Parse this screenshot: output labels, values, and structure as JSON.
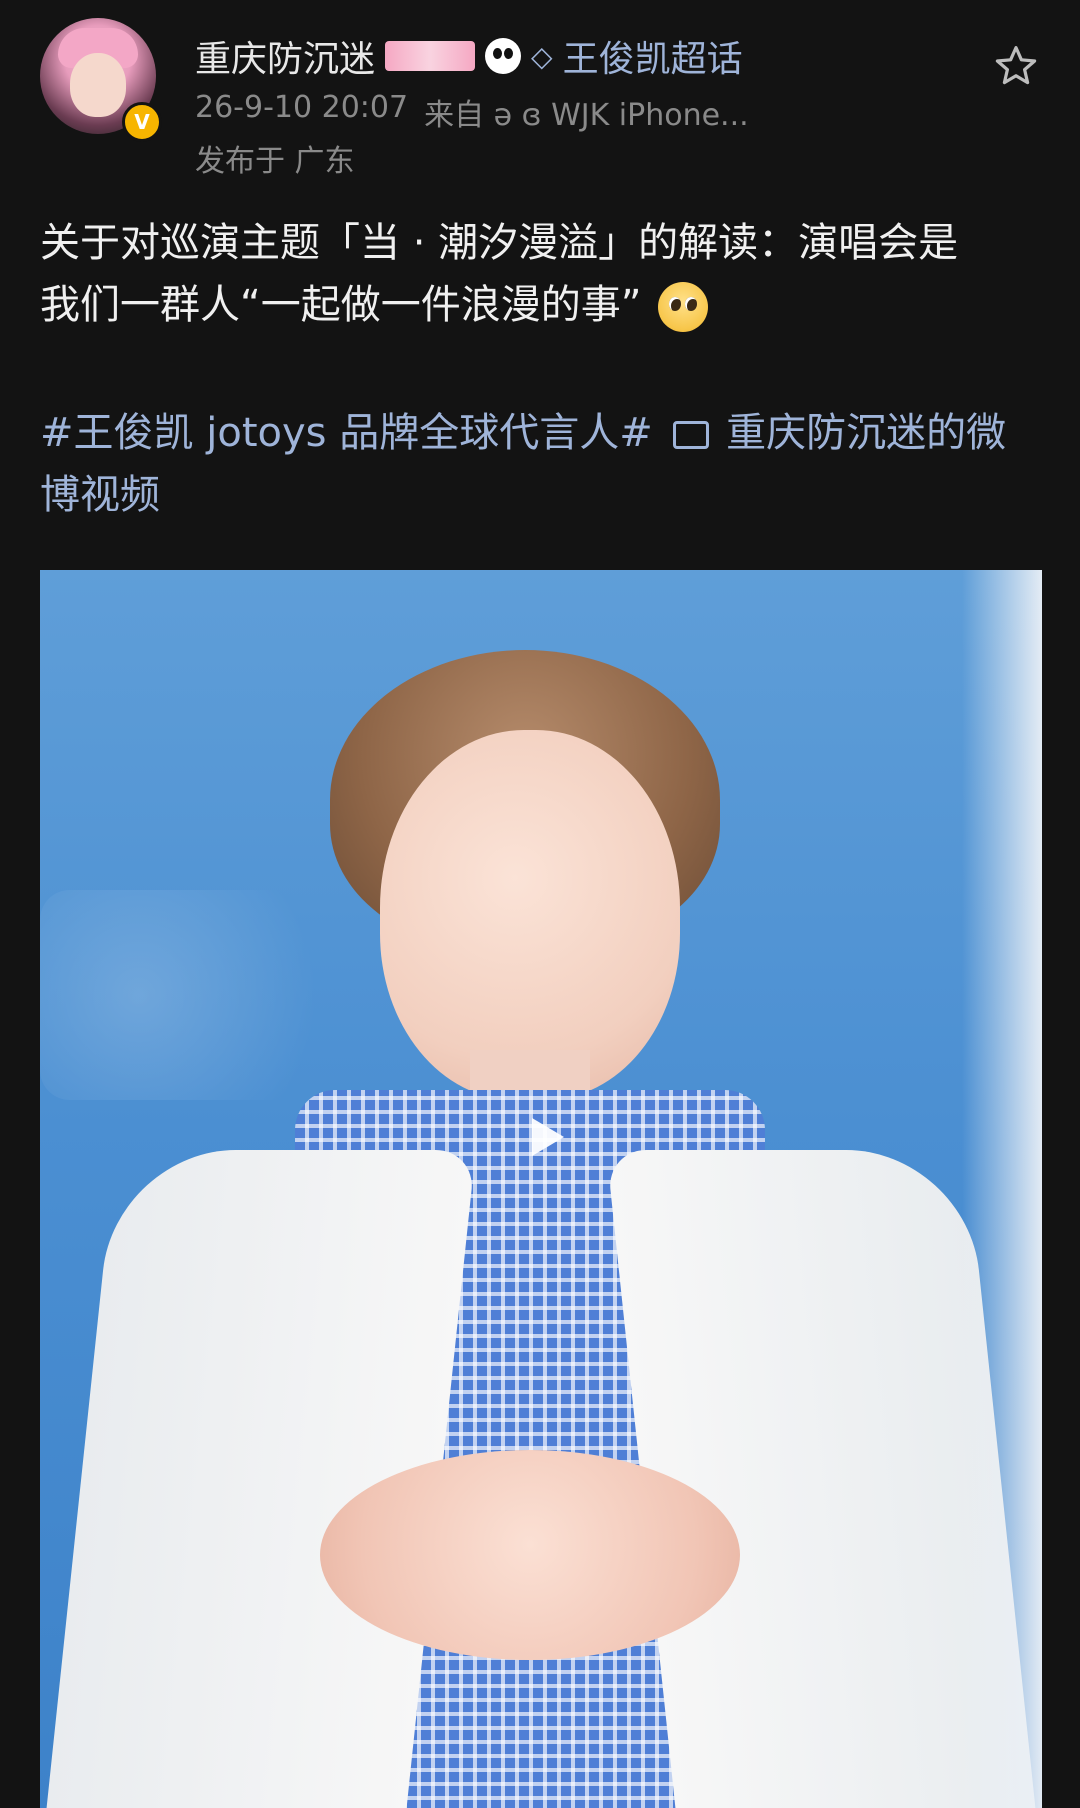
{
  "header": {
    "username": "重庆防沉迷",
    "supertopic": "王俊凯超话",
    "timestamp": "26-9-10 20:07",
    "source": "来自 ə ɞ WJK iPhone...",
    "location": "发布于 广东"
  },
  "post": {
    "line1": "关于对巡演主题「当 · 潮汐漫溢」的解读：演唱会是",
    "line2": "我们一群人“一起做一件浪漫的事”",
    "topics_prefix": "#王俊凯 jotoys 品牌全球代言人#",
    "topics_video_link": "重庆防沉迷的微博视频"
  },
  "icons": {
    "verified": "verified-badge-icon",
    "star": "star-icon",
    "play": "play-icon",
    "diamond": "diamond-icon",
    "video_link": "video-link-icon",
    "emoji": "pleading-face-emoji-icon"
  },
  "colors": {
    "background": "#131313",
    "text": "#f0f0f0",
    "muted": "#8a8a8a",
    "link": "#9fb4d9",
    "verified": "#f7b500"
  }
}
